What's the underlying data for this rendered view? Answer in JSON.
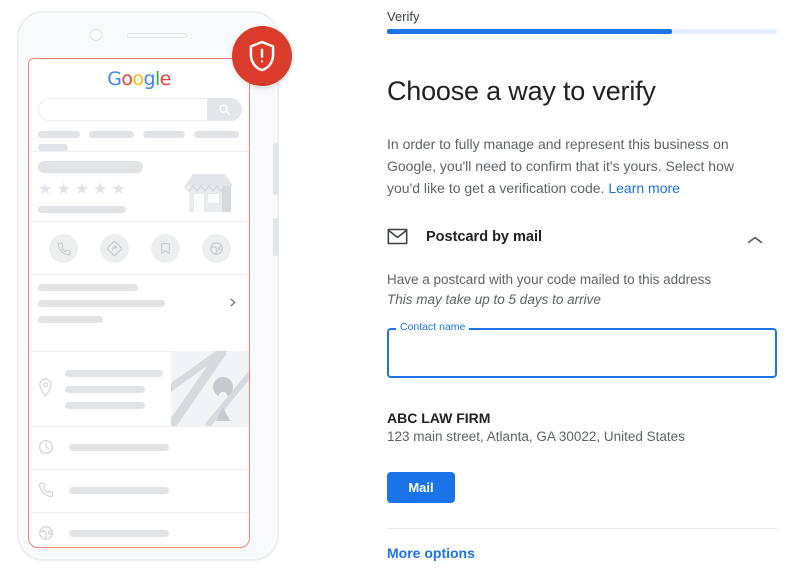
{
  "wizard": {
    "step_label": "Verify",
    "progress_percent": 73,
    "progress_color": "#1a73e8",
    "track_color": "#e8f0fe"
  },
  "main": {
    "heading": "Choose a way to verify",
    "description": "In order to fully manage and represent this business on Google, you'll need to confirm that it's yours. Select how you'd like to get a verification code.",
    "learn_more_label": "Learn more",
    "learn_more_color": "#1a73e8"
  },
  "method": {
    "icon": "envelope-icon",
    "title": "Postcard by mail",
    "expanded": true,
    "collapse_icon": "chevron-up-icon",
    "description": "Have a postcard with your code mailed to this address",
    "note": "This may take up to 5 days to arrive",
    "contact_field": {
      "label": "Contact name",
      "value": "",
      "placeholder": "",
      "focused": true,
      "accent_color": "#1a73e8"
    },
    "business_name": "ABC LAW FIRM",
    "business_address": "123 main street, Atlanta, GA 30022, United States",
    "submit_label": "Mail",
    "submit_color": "#1a73e8"
  },
  "footer": {
    "more_options_label": "More options",
    "more_options_color": "#1a73e8"
  },
  "illustration": {
    "badge": {
      "icon": "shield-alert-icon",
      "color": "#db3b2b"
    },
    "phone": {
      "brand_logo": "Google",
      "brand_letters": [
        {
          "char": "G",
          "color": "#4285F4"
        },
        {
          "char": "o",
          "color": "#EA4335"
        },
        {
          "char": "o",
          "color": "#FBBC05"
        },
        {
          "char": "g",
          "color": "#4285F4"
        },
        {
          "char": "l",
          "color": "#34A853"
        },
        {
          "char": "e",
          "color": "#EA4335"
        }
      ],
      "search_icon": "search-icon",
      "rating_stars": 5,
      "storefront_icon": "storefront-icon",
      "action_icons": [
        "phone-icon",
        "directions-icon",
        "bookmark-icon",
        "share-icon"
      ],
      "list_icons": [
        "clock-icon",
        "phone-icon",
        "globe-icon"
      ],
      "map_pin_icon": "map-pin-icon",
      "chevron_icon": "chevron-right-icon",
      "highlight_color": "#ee8476"
    }
  }
}
